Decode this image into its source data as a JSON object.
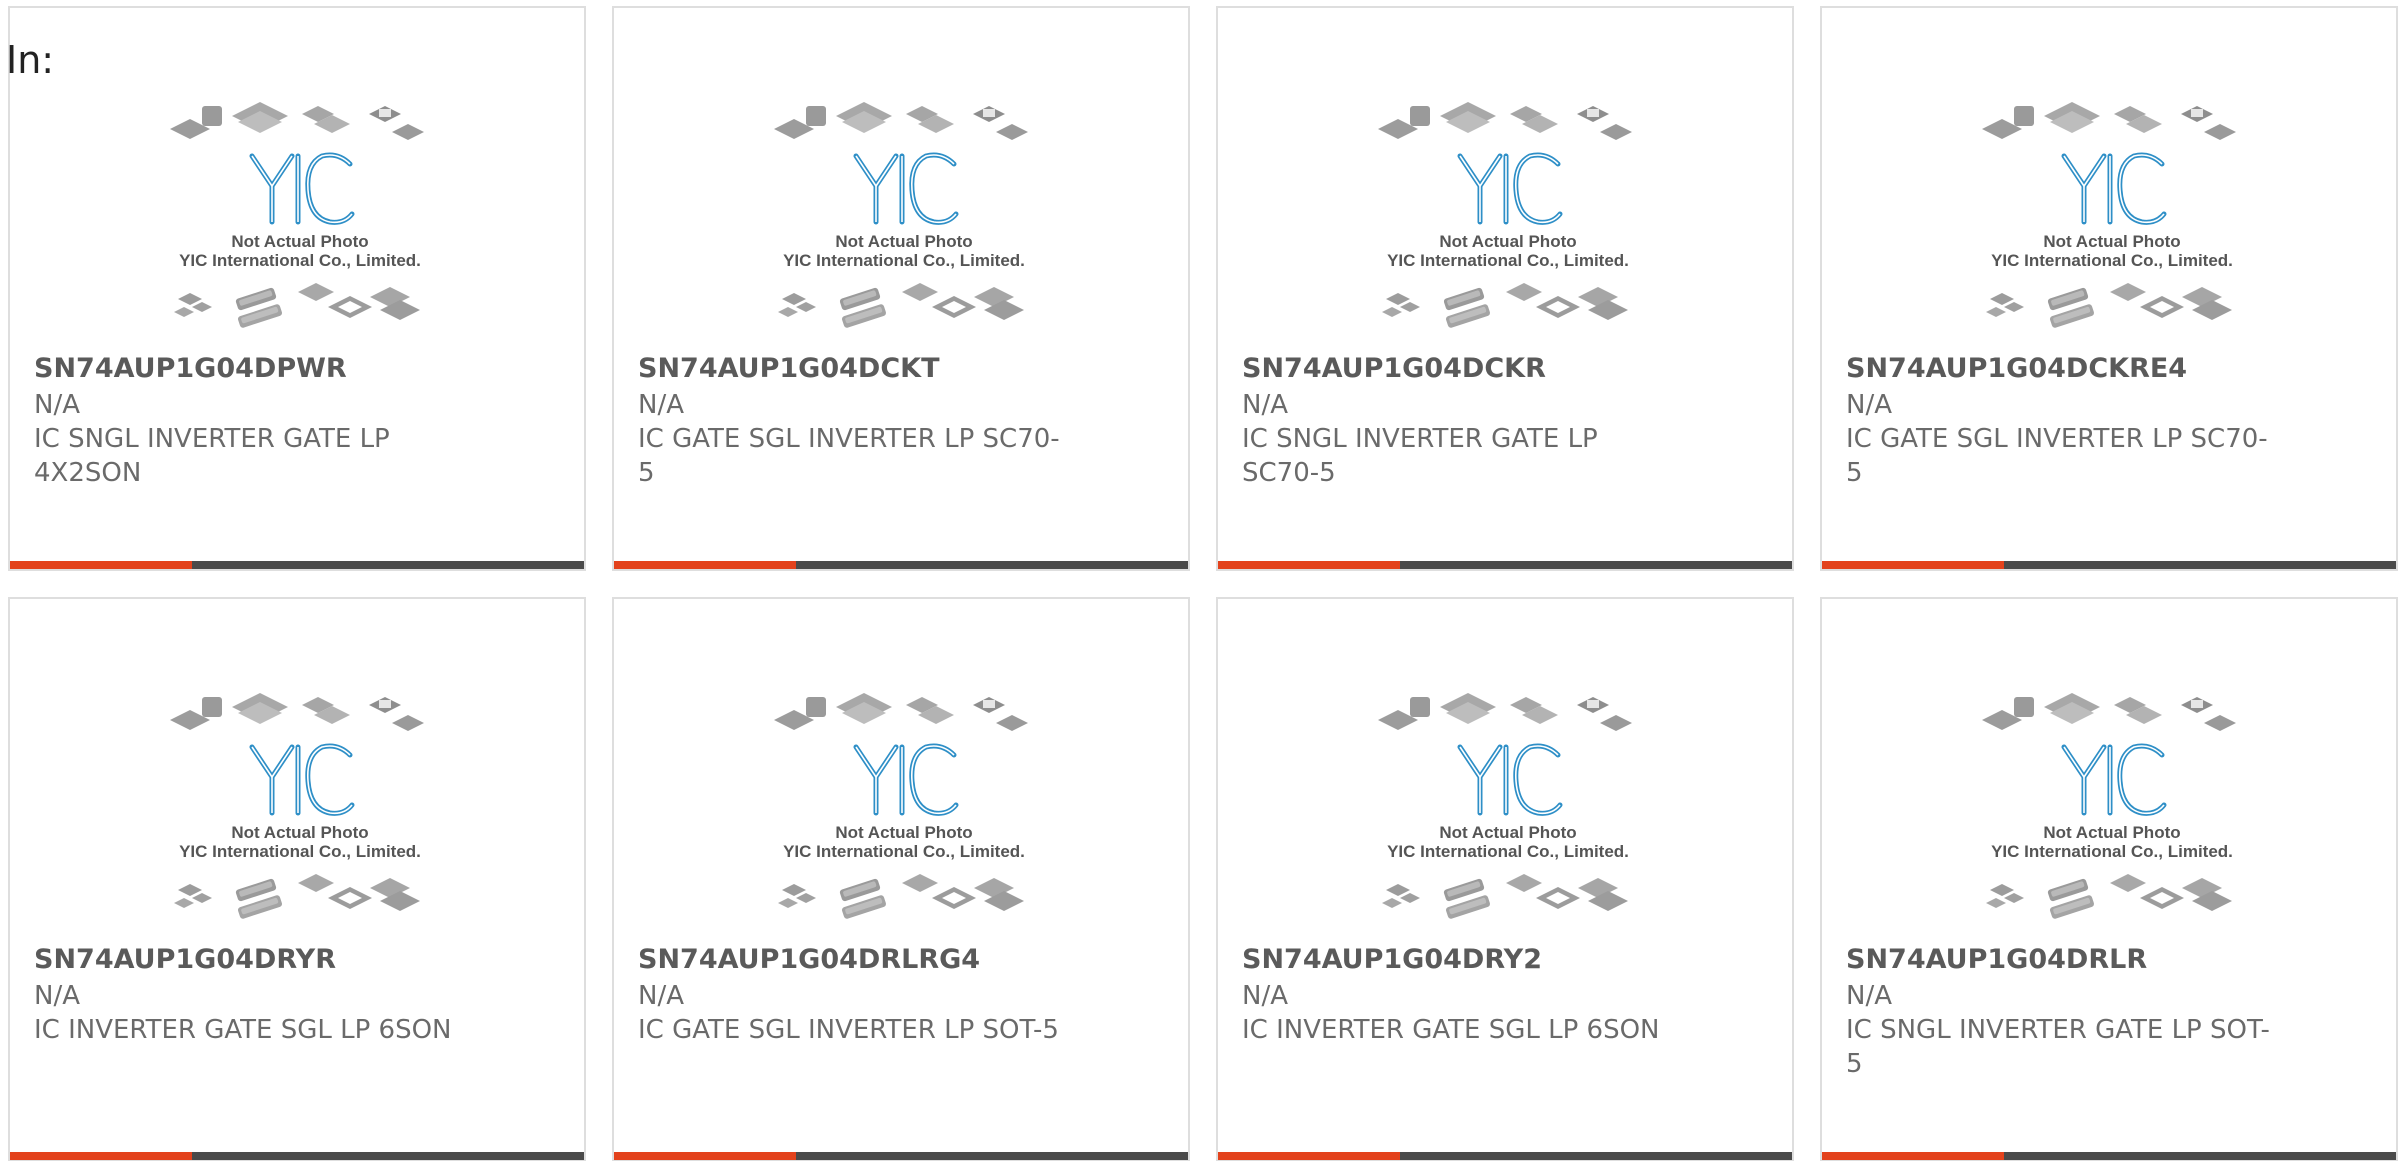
{
  "header": {
    "label": "In:"
  },
  "colors": {
    "accent": "#e3421c",
    "bar": "#4a4a4a",
    "logo": "#2e8fc7",
    "card_border": "#dedede"
  },
  "placeholder": {
    "line1": "Not Actual Photo",
    "line2": "YIC International Co., Limited.",
    "logo_icon": "yic-logo-icon"
  },
  "products": [
    {
      "part": "SN74AUP1G04DPWR",
      "mfr": "N/A",
      "desc": "IC SNGL INVERTER GATE LP 4X2SON"
    },
    {
      "part": "SN74AUP1G04DCKT",
      "mfr": "N/A",
      "desc": "IC GATE SGL INVERTER LP SC70-5"
    },
    {
      "part": "SN74AUP1G04DCKR",
      "mfr": "N/A",
      "desc": "IC SNGL INVERTER GATE LP SC70-5"
    },
    {
      "part": "SN74AUP1G04DCKRE4",
      "mfr": "N/A",
      "desc": "IC GATE SGL INVERTER LP SC70-5"
    },
    {
      "part": "SN74AUP1G04DRYR",
      "mfr": "N/A",
      "desc": "IC INVERTER GATE SGL LP 6SON"
    },
    {
      "part": "SN74AUP1G04DRLRG4",
      "mfr": "N/A",
      "desc": "IC GATE SGL INVERTER LP SOT-5"
    },
    {
      "part": "SN74AUP1G04DRY2",
      "mfr": "N/A",
      "desc": "IC INVERTER GATE SGL LP 6SON"
    },
    {
      "part": "SN74AUP1G04DRLR",
      "mfr": "N/A",
      "desc": "IC SNGL INVERTER GATE LP SOT-5"
    }
  ]
}
